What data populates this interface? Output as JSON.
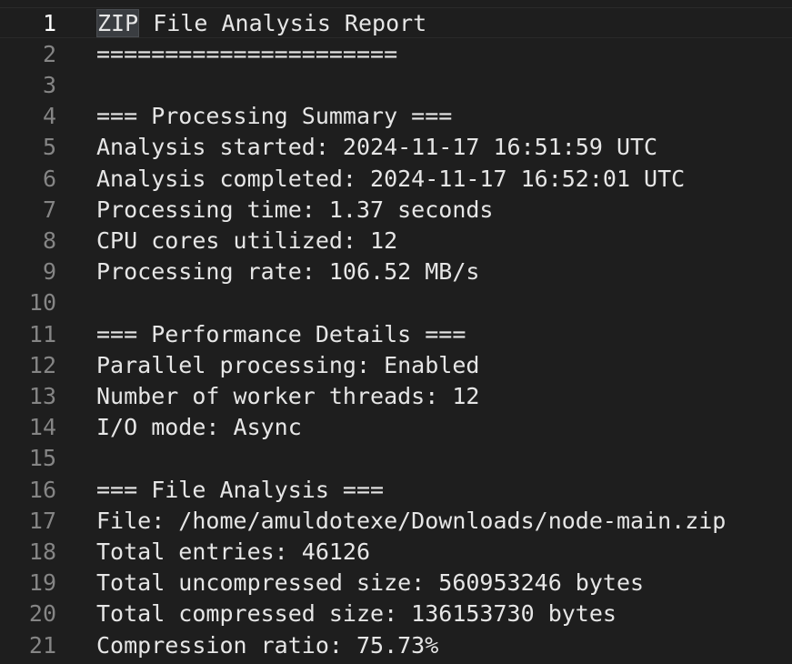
{
  "editor": {
    "cursor_line": 1,
    "highlighted_word": "ZIP",
    "lines": [
      {
        "num": "1",
        "text": "ZIP File Analysis Report"
      },
      {
        "num": "2",
        "text": "======================"
      },
      {
        "num": "3",
        "text": ""
      },
      {
        "num": "4",
        "text": "=== Processing Summary ==="
      },
      {
        "num": "5",
        "text": "Analysis started: 2024-11-17 16:51:59 UTC"
      },
      {
        "num": "6",
        "text": "Analysis completed: 2024-11-17 16:52:01 UTC"
      },
      {
        "num": "7",
        "text": "Processing time: 1.37 seconds"
      },
      {
        "num": "8",
        "text": "CPU cores utilized: 12"
      },
      {
        "num": "9",
        "text": "Processing rate: 106.52 MB/s"
      },
      {
        "num": "10",
        "text": ""
      },
      {
        "num": "11",
        "text": "=== Performance Details ==="
      },
      {
        "num": "12",
        "text": "Parallel processing: Enabled"
      },
      {
        "num": "13",
        "text": "Number of worker threads: 12"
      },
      {
        "num": "14",
        "text": "I/O mode: Async"
      },
      {
        "num": "15",
        "text": ""
      },
      {
        "num": "16",
        "text": "=== File Analysis ==="
      },
      {
        "num": "17",
        "text": "File: /home/amuldotexe/Downloads/node-main.zip"
      },
      {
        "num": "18",
        "text": "Total entries: 46126"
      },
      {
        "num": "19",
        "text": "Total uncompressed size: 560953246 bytes"
      },
      {
        "num": "20",
        "text": "Total compressed size: 136153730 bytes"
      },
      {
        "num": "21",
        "text": "Compression ratio: 75.73%"
      }
    ]
  }
}
